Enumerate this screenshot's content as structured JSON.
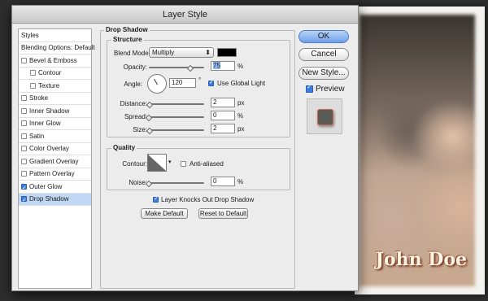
{
  "window": {
    "title": "Layer Style"
  },
  "sidebar": {
    "items": [
      {
        "label": "Styles",
        "has_checkbox": false,
        "checked": false,
        "indent": false,
        "selected": false
      },
      {
        "label": "Blending Options: Default",
        "has_checkbox": false,
        "checked": false,
        "indent": false,
        "selected": false
      },
      {
        "label": "Bevel & Emboss",
        "has_checkbox": true,
        "checked": false,
        "indent": false,
        "selected": false
      },
      {
        "label": "Contour",
        "has_checkbox": true,
        "checked": false,
        "indent": true,
        "selected": false
      },
      {
        "label": "Texture",
        "has_checkbox": true,
        "checked": false,
        "indent": true,
        "selected": false
      },
      {
        "label": "Stroke",
        "has_checkbox": true,
        "checked": false,
        "indent": false,
        "selected": false
      },
      {
        "label": "Inner Shadow",
        "has_checkbox": true,
        "checked": false,
        "indent": false,
        "selected": false
      },
      {
        "label": "Inner Glow",
        "has_checkbox": true,
        "checked": false,
        "indent": false,
        "selected": false
      },
      {
        "label": "Satin",
        "has_checkbox": true,
        "checked": false,
        "indent": false,
        "selected": false
      },
      {
        "label": "Color Overlay",
        "has_checkbox": true,
        "checked": false,
        "indent": false,
        "selected": false
      },
      {
        "label": "Gradient Overlay",
        "has_checkbox": true,
        "checked": false,
        "indent": false,
        "selected": false
      },
      {
        "label": "Pattern Overlay",
        "has_checkbox": true,
        "checked": false,
        "indent": false,
        "selected": false
      },
      {
        "label": "Outer Glow",
        "has_checkbox": true,
        "checked": true,
        "indent": false,
        "selected": false
      },
      {
        "label": "Drop Shadow",
        "has_checkbox": true,
        "checked": true,
        "indent": false,
        "selected": true
      }
    ]
  },
  "drop_shadow": {
    "title": "Drop Shadow",
    "structure": {
      "title": "Structure",
      "blend_mode_label": "Blend Mode:",
      "blend_mode_value": "Multiply",
      "shadow_color": "#000000",
      "opacity_label": "Opacity:",
      "opacity_value": "75",
      "opacity_fraction": 0.75,
      "angle_label": "Angle:",
      "angle_value": "120",
      "degree_symbol": "°",
      "use_global_light_label": "Use Global Light",
      "use_global_light_checked": true,
      "distance_label": "Distance:",
      "distance_value": "2",
      "distance_fraction": 0.02,
      "spread_label": "Spread:",
      "spread_value": "0",
      "spread_fraction": 0.0,
      "size_label": "Size:",
      "size_value": "2",
      "size_fraction": 0.02,
      "px_unit": "px",
      "pct_unit": "%"
    },
    "quality": {
      "title": "Quality",
      "contour_label": "Contour:",
      "anti_aliased_label": "Anti-aliased",
      "anti_aliased_checked": false,
      "noise_label": "Noise:",
      "noise_value": "0",
      "noise_fraction": 0.0
    },
    "knocks_out_label": "Layer Knocks Out Drop Shadow",
    "knocks_out_checked": true,
    "make_default_label": "Make Default",
    "reset_default_label": "Reset to Default"
  },
  "actions": {
    "ok_label": "OK",
    "cancel_label": "Cancel",
    "new_style_label": "New Style...",
    "preview_label": "Preview",
    "preview_checked": true
  },
  "background": {
    "name_text": "John Doe"
  }
}
